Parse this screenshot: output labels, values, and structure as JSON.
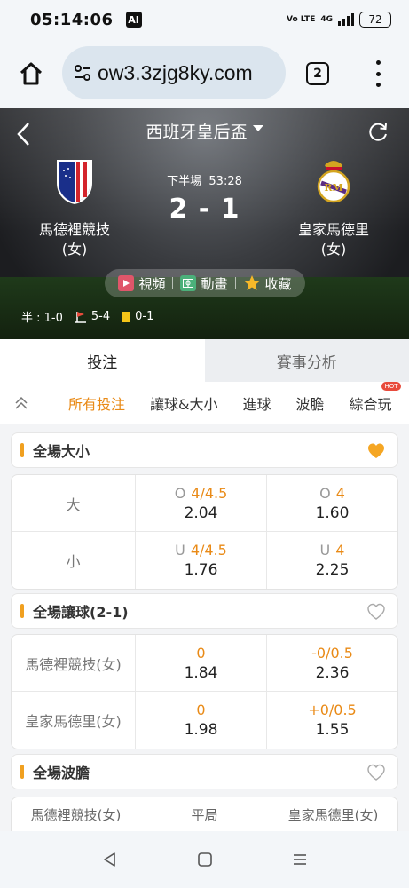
{
  "status_bar": {
    "time": "05:14:06",
    "ai_badge": "AI",
    "volte": "Vo LTE",
    "network": "4G",
    "battery": "72"
  },
  "browser": {
    "url": "ow3.3zjg8ky.com",
    "tab_count": "2"
  },
  "match": {
    "league": "西班牙皇后盃",
    "period": "下半場",
    "clock": "53:28",
    "score": "2 - 1",
    "home_team": "馬德裡競技",
    "home_sub": "(女)",
    "away_team": "皇家馬德里",
    "away_sub": "(女)",
    "media": {
      "video": "視頻",
      "animation": "動畫",
      "favorite": "收藏"
    },
    "stats": {
      "half": "半 : 1-0",
      "corners": "5-4",
      "yellow": "0-1"
    }
  },
  "main_tabs": [
    "投注",
    "賽事分析"
  ],
  "sub_tabs": [
    "所有投注",
    "讓球&大小",
    "進球",
    "波膽",
    "綜合玩"
  ],
  "hot_badge": "HOT",
  "sections": {
    "total": {
      "title": "全場大小",
      "rows": [
        {
          "label": "大",
          "cells": [
            {
              "prefix": "O",
              "handicap": "4/4.5",
              "price": "2.04"
            },
            {
              "prefix": "O",
              "handicap": "4",
              "price": "1.60"
            }
          ]
        },
        {
          "label": "小",
          "cells": [
            {
              "prefix": "U",
              "handicap": "4/4.5",
              "price": "1.76"
            },
            {
              "prefix": "U",
              "handicap": "4",
              "price": "2.25"
            }
          ]
        }
      ]
    },
    "handicap": {
      "title": "全場讓球(2-1)",
      "rows": [
        {
          "label": "馬德裡競技(女)",
          "cells": [
            {
              "prefix": "",
              "handicap": "0",
              "price": "1.84"
            },
            {
              "prefix": "",
              "handicap": "-0/0.5",
              "price": "2.36"
            }
          ]
        },
        {
          "label": "皇家馬德里(女)",
          "cells": [
            {
              "prefix": "",
              "handicap": "0",
              "price": "1.98"
            },
            {
              "prefix": "",
              "handicap": "+0/0.5",
              "price": "1.55"
            }
          ]
        }
      ]
    },
    "correct_score": {
      "title": "全場波膽",
      "columns": [
        "馬德裡競技(女)",
        "平局",
        "皇家馬德里(女)"
      ]
    }
  },
  "colors": {
    "accent": "#e98a16",
    "section_bar": "#f0a020",
    "favorite_heart": "#f5a623"
  }
}
